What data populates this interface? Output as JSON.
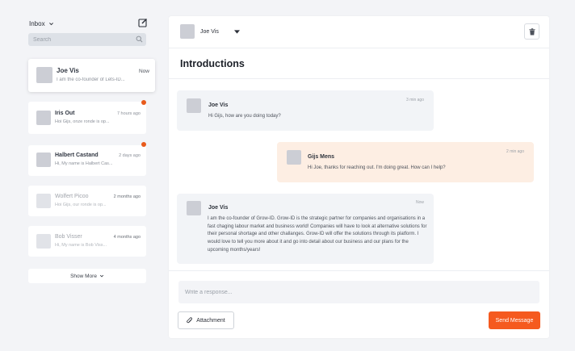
{
  "sidebar": {
    "inbox_label": "Inbox",
    "search_placeholder": "Search",
    "show_more": "Show More",
    "conversations": [
      {
        "name": "Joe Vis",
        "preview": "I am the co-founder of Lets-ID...",
        "time": "Now",
        "unread": false,
        "active": true,
        "muted": false
      },
      {
        "name": "Iris Out",
        "preview": "Hoi Gijs, onze ronde is op...",
        "time": "7 hours ago",
        "unread": true,
        "active": false,
        "muted": false
      },
      {
        "name": "Halbert Castand",
        "preview": "Hi, My name is Halbert Cas...",
        "time": "2 days ago",
        "unread": true,
        "active": false,
        "muted": false
      },
      {
        "name": "Wolfert Picoo",
        "preview": "Hoi Gijs, our ronde is op...",
        "time": "2 months ago",
        "unread": false,
        "active": false,
        "muted": true
      },
      {
        "name": "Bob Visser",
        "preview": "Hi, My name is Bob Viss...",
        "time": "4 months ago",
        "unread": false,
        "active": false,
        "muted": true
      }
    ]
  },
  "header": {
    "contact_name": "Joe Vis",
    "conversation_title": "Introductions"
  },
  "messages": [
    {
      "sender": "Joe Vis",
      "time": "3 min ago",
      "text": "Hi Gijs, how are you doing today?",
      "mine": false
    },
    {
      "sender": "Gijs Mens",
      "time": "2 min ago",
      "text": "Hi Joe, thanks for reaching out. I'm doing great. How can I help?",
      "mine": true
    },
    {
      "sender": "Joe Vis",
      "time": "Now",
      "text": "I am the co-founder of Grow-ID. Grow-ID is the strategic partner for companies and organisations in a fast chaging labour market and business world! Companies will have to look at alternative solutions for their personal shortage and other challanges. Grow-ID will offer the solutions through its platform. I would love to tell you more about it and go into detail about our business and our plans for the upcoming months/years!",
      "mine": false
    }
  ],
  "composer": {
    "placeholder": "Write a response...",
    "attachment_label": "Attachment",
    "send_label": "Send Message"
  },
  "colors": {
    "accent": "#f55a1f",
    "unread_dot": "#e85a1b",
    "my_bubble": "#fdeee3",
    "their_bubble": "#f2f4f7"
  }
}
